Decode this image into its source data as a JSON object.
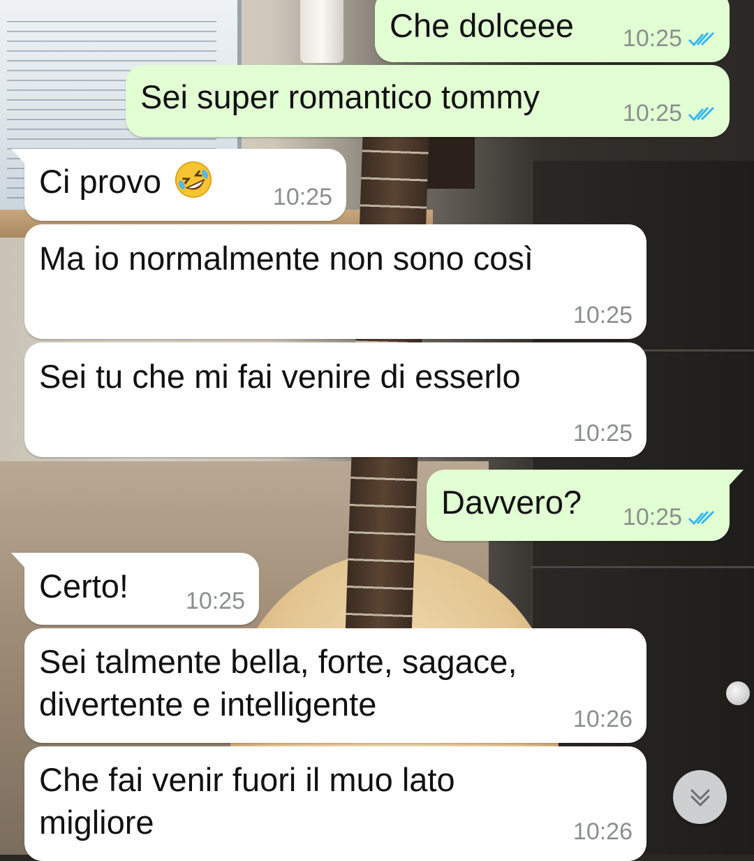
{
  "theme": {
    "outgoing_bubble": "#e2ffd4",
    "incoming_bubble": "#ffffff",
    "read_ticks": "#34b7f1",
    "time_text": "#8a8f8c"
  },
  "messages": [
    {
      "direction": "out",
      "text": "Che dolceee",
      "time": "10:25",
      "status": "read"
    },
    {
      "direction": "out",
      "text": "Sei super romantico tommy",
      "time": "10:25",
      "status": "read"
    },
    {
      "direction": "in",
      "text": "Ci provo",
      "emoji": "rolling-on-floor-laughing",
      "time": "10:25"
    },
    {
      "direction": "in",
      "text": "Ma io normalmente non sono così",
      "time": "10:25"
    },
    {
      "direction": "in",
      "text": "Sei tu che mi fai venire di esserlo",
      "time": "10:25"
    },
    {
      "direction": "out",
      "text": "Davvero?",
      "time": "10:25",
      "status": "read"
    },
    {
      "direction": "in",
      "text": "Certo!",
      "time": "10:25"
    },
    {
      "direction": "in",
      "lines": [
        "Sei talmente bella, forte, sagace,",
        "divertente e intelligente"
      ],
      "time": "10:26"
    },
    {
      "direction": "in",
      "lines": [
        "Che fai venir fuori il muo lato",
        "migliore"
      ],
      "time": "10:26"
    }
  ],
  "scroll_to_bottom": {
    "icon": "double-chevron-down-icon"
  }
}
